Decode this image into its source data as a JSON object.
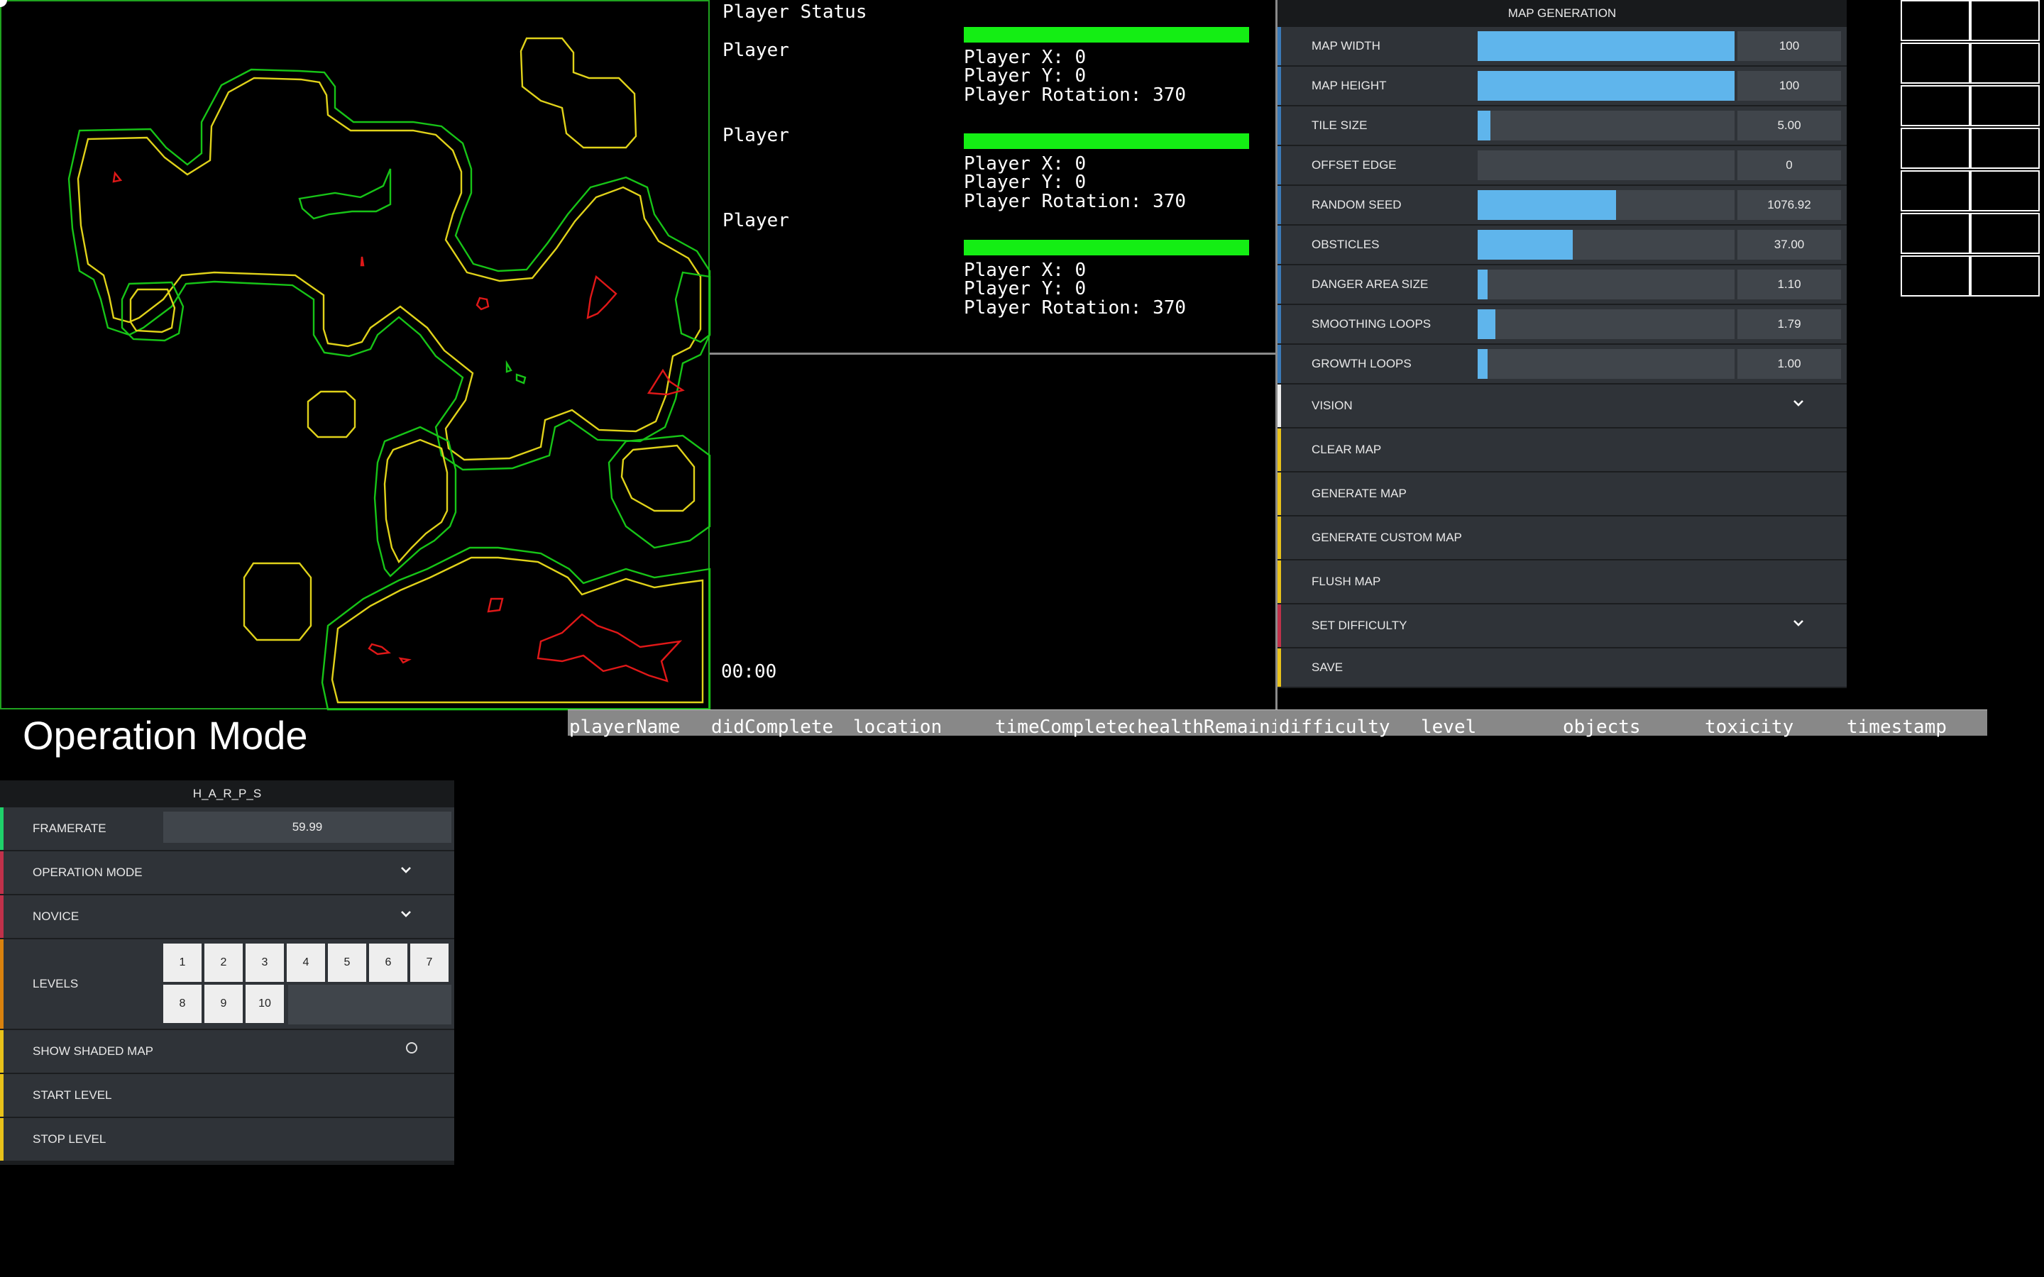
{
  "player_status": {
    "title": "Player Status",
    "players": [
      {
        "name": "Player",
        "x_line": "Player X: 0",
        "y_line": "Player Y: 0",
        "rot_line": "Player Rotation: 370",
        "health": 1.0
      },
      {
        "name": "Player",
        "x_line": "Player X: 0",
        "y_line": "Player Y: 0",
        "rot_line": "Player Rotation: 370",
        "health": 1.0
      },
      {
        "name": "Player",
        "x_line": "Player X: 0",
        "y_line": "Player Y: 0",
        "rot_line": "Player Rotation: 370",
        "health": 1.0
      }
    ]
  },
  "timer": "00:00",
  "map_generation": {
    "header": "MAP GENERATION",
    "sliders": [
      {
        "label": "MAP WIDTH",
        "value": "100",
        "fill": 1.0
      },
      {
        "label": "MAP HEIGHT",
        "value": "100",
        "fill": 1.0
      },
      {
        "label": "TILE SIZE",
        "value": "5.00",
        "fill": 0.05
      },
      {
        "label": "OFFSET EDGE",
        "value": "0",
        "fill": 0.0
      },
      {
        "label": "RANDOM SEED",
        "value": "1076.92",
        "fill": 0.54
      },
      {
        "label": "OBSTICLES",
        "value": "37.00",
        "fill": 0.37
      },
      {
        "label": "DANGER AREA SIZE",
        "value": "1.10",
        "fill": 0.04
      },
      {
        "label": "SMOOTHING LOOPS",
        "value": "1.79",
        "fill": 0.07
      },
      {
        "label": "GROWTH LOOPS",
        "value": "1.00",
        "fill": 0.04
      }
    ],
    "vision_label": "VISION",
    "clear_label": "CLEAR MAP",
    "generate_label": "GENERATE MAP",
    "generate_custom_label": "GENERATE CUSTOM MAP",
    "flush_label": "FLUSH MAP",
    "difficulty_label": "SET DIFFICULTY",
    "save_label": "SAVE"
  },
  "operation_title": "Operation Mode",
  "harps": {
    "header": "H_A_R_P_S",
    "framerate_label": "FRAMERATE",
    "framerate_value": "59.99",
    "operation_mode_label": "OPERATION MODE",
    "novice_label": "NOVICE",
    "levels_label": "LEVELS",
    "levels": [
      "1",
      "2",
      "3",
      "4",
      "5",
      "6",
      "7",
      "8",
      "9",
      "10"
    ],
    "show_shaded_label": "SHOW SHADED MAP",
    "start_label": "START LEVEL",
    "stop_label": "STOP LEVEL"
  },
  "results_columns": [
    "playerName",
    "didComplete",
    "location",
    "timeCompleted",
    "healthRemaining",
    "difficulty",
    "level",
    "objects",
    "toxicity",
    "timestamp"
  ],
  "colors": {
    "slider_fill": "#5fb5ec",
    "health": "#14ee14",
    "accent_blue": "#3a7ab8",
    "accent_white": "#eeeeee",
    "accent_yellow": "#e8c21a",
    "accent_red": "#c0314a",
    "accent_green": "#1fd16a",
    "accent_orange": "#d9820e",
    "map_green": "#17c417",
    "map_yellow": "#e0d21a",
    "map_red": "#e01818"
  }
}
